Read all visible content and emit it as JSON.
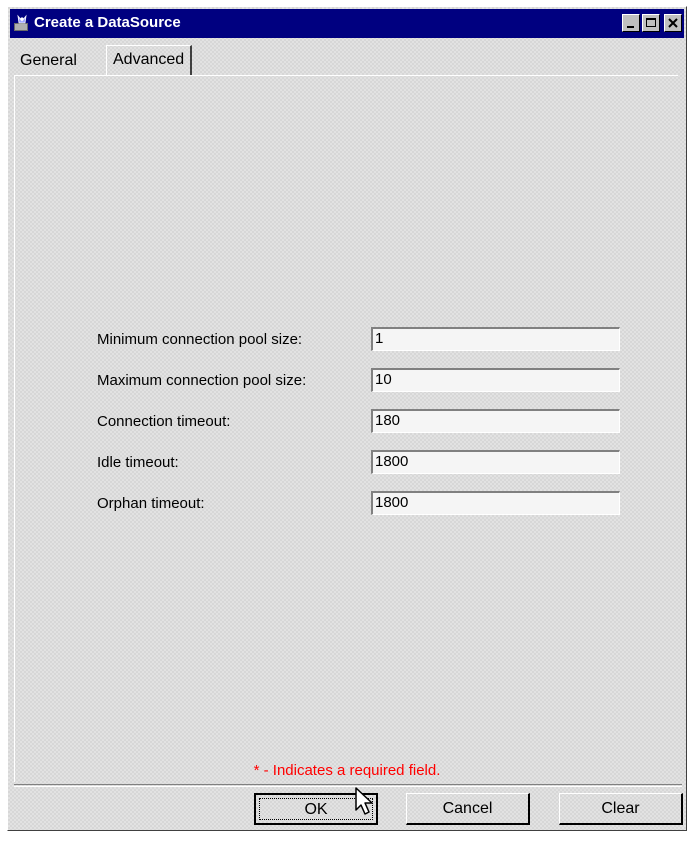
{
  "window": {
    "title": "Create a DataSource",
    "controls": [
      "minimize-icon",
      "maximize-icon",
      "close-icon"
    ]
  },
  "tabs": [
    {
      "label": "General",
      "selected": false
    },
    {
      "label": "Advanced",
      "selected": true
    }
  ],
  "form": {
    "fields": [
      {
        "label": "Minimum connection pool size:",
        "value": "1"
      },
      {
        "label": "Maximum connection pool size:",
        "value": "10"
      },
      {
        "label": "Connection timeout:",
        "value": "180"
      },
      {
        "label": "Idle timeout:",
        "value": "1800"
      },
      {
        "label": "Orphan timeout:",
        "value": "1800"
      }
    ]
  },
  "required_note": "* - Indicates a required field.",
  "buttons": {
    "ok": "OK",
    "cancel": "Cancel",
    "clear": "Clear"
  },
  "colors": {
    "titlebar": "#000080",
    "required_note": "#ff0000"
  }
}
